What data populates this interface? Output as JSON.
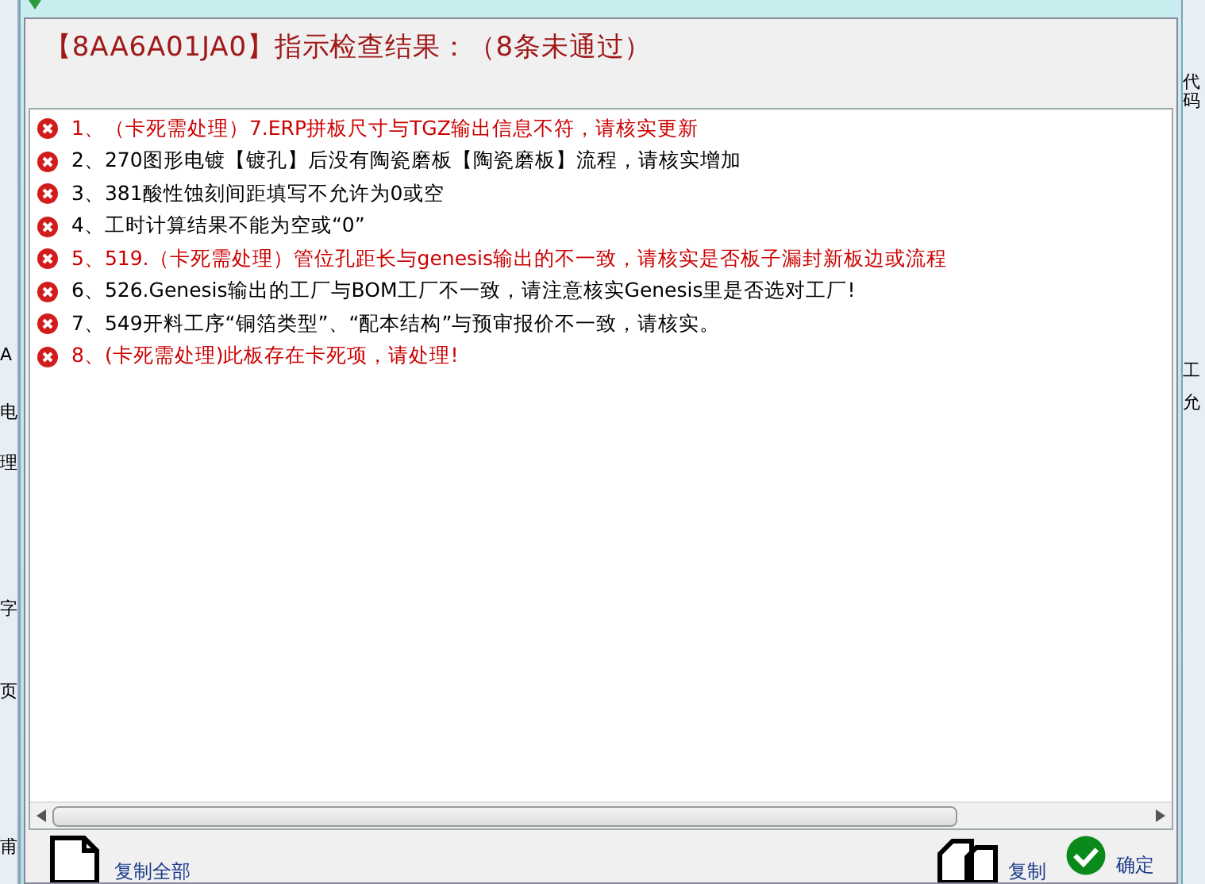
{
  "background": {
    "left_text": [
      "A",
      "电",
      "理",
      "字",
      "页",
      "甫"
    ],
    "right_text": [
      "代码",
      "工",
      "允"
    ]
  },
  "dialog": {
    "heading": "【8AA6A01JA0】指示检查结果：（8条未通过）",
    "items": [
      {
        "text": "1、（卡死需处理）7.ERP拼板尺寸与TGZ输出信息不符，请核实更新",
        "color": "#cc0000"
      },
      {
        "text": "2、270图形电镀【镀孔】后没有陶瓷磨板【陶瓷磨板】流程，请核实增加",
        "color": "#000000"
      },
      {
        "text": "3、381酸性蚀刻间距填写不允许为0或空",
        "color": "#000000"
      },
      {
        "text": "4、工时计算结果不能为空或“0”",
        "color": "#000000"
      },
      {
        "text": "5、519.（卡死需处理）管位孔距长与genesis输出的不一致，请核实是否板子漏封新板边或流程",
        "color": "#cc0000"
      },
      {
        "text": "6、526.Genesis输出的工厂与BOM工厂不一致，请注意核实Genesis里是否选对工厂!",
        "color": "#000000"
      },
      {
        "text": "7、549开料工序“铜箔类型”、“配本结构”与预审报价不一致，请核实。",
        "color": "#000000"
      },
      {
        "text": "8、(卡死需处理)此板存在卡死项，请处理!",
        "color": "#cc0000"
      }
    ],
    "buttons": [
      {
        "label": "复制全部",
        "kind": "copy_all"
      },
      {
        "label": "复制",
        "kind": "copy"
      },
      {
        "label": "确定",
        "kind": "ok"
      }
    ]
  }
}
